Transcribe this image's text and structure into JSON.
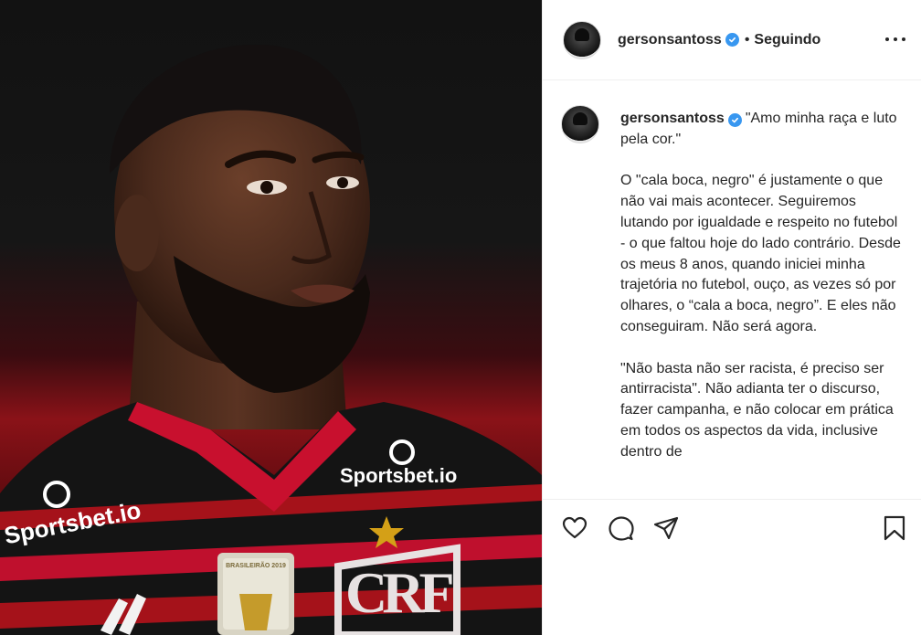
{
  "post": {
    "username": "gersonsantoss",
    "separator": "•",
    "follow_status": "Seguindo",
    "caption_title": "\"Amo minha raça e luto pela cor.\"",
    "caption_paragraphs": [
      "O \"cala boca, negro\" é justamente o que não vai mais acontecer. Seguiremos lutando por igualdade e respeito no futebol - o que faltou hoje do lado contrário. Desde os meus 8 anos, quando iniciei minha trajetória no futebol, ouço, as vezes só por olhares, o “cala a boca, negro”. E eles não conseguiram. Não será agora.",
      "\"Não basta não ser racista, é preciso ser antirracista\". Não adianta ter o discurso, fazer campanha, e não colocar em prática em todos os aspectos da vida, inclusive dentro de"
    ]
  },
  "photo": {
    "jersey_sponsor_chest": "Sportsbet.io",
    "jersey_sponsor_shoulder": "Sportsbet.io",
    "badge_text": "BRASILEIRÃO 2019",
    "crest_text": "CRF"
  },
  "icons": {
    "more": "more-options-icon",
    "verified": "verified-badge-icon",
    "like": "heart-icon",
    "comment": "comment-icon",
    "share": "paper-plane-icon",
    "save": "bookmark-icon"
  },
  "colors": {
    "verified_blue": "#3897f0",
    "jersey_red": "#c8102e",
    "jersey_black": "#111111",
    "border": "#efefef",
    "text": "#262626"
  }
}
